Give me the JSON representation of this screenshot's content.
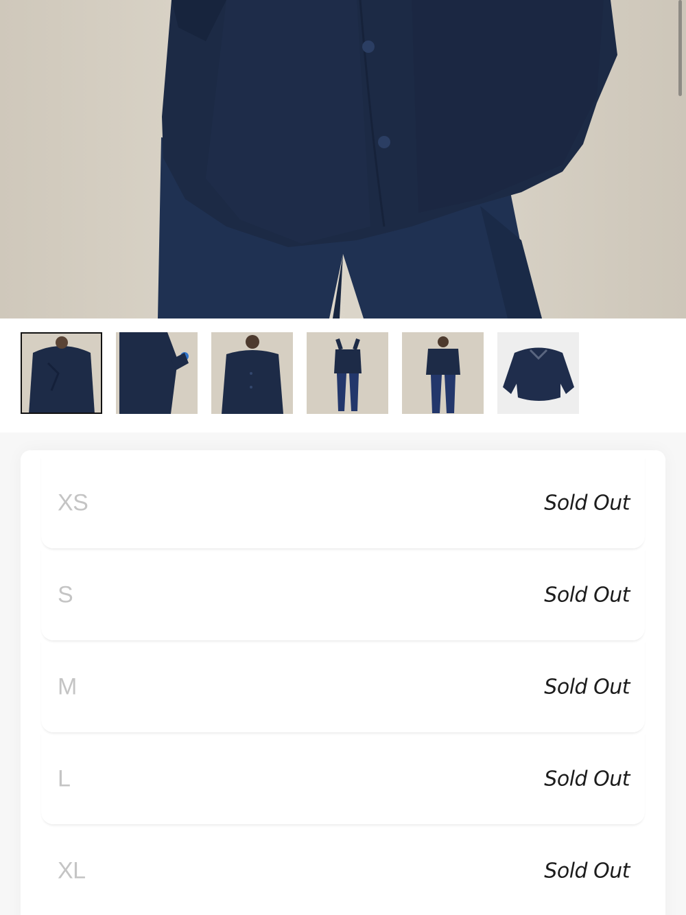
{
  "product": {
    "main_image": "navy-sherpa-shirt-jacket-photo",
    "thumbnails": [
      {
        "name": "thumbnail-1",
        "active": true
      },
      {
        "name": "thumbnail-2",
        "active": false
      },
      {
        "name": "thumbnail-3",
        "active": false
      },
      {
        "name": "thumbnail-4",
        "active": false
      },
      {
        "name": "thumbnail-5",
        "active": false
      },
      {
        "name": "thumbnail-6",
        "active": false
      }
    ]
  },
  "sizes": [
    {
      "label": "XS",
      "status": "Sold Out"
    },
    {
      "label": "S",
      "status": "Sold Out"
    },
    {
      "label": "M",
      "status": "Sold Out"
    },
    {
      "label": "L",
      "status": "Sold Out"
    },
    {
      "label": "XL",
      "status": "Sold Out"
    }
  ],
  "colors": {
    "navy": "#1d2a45",
    "backdrop": "#d8d2c6",
    "sold_out_text": "#1c1c1c",
    "size_label": "#c4c4c4"
  }
}
